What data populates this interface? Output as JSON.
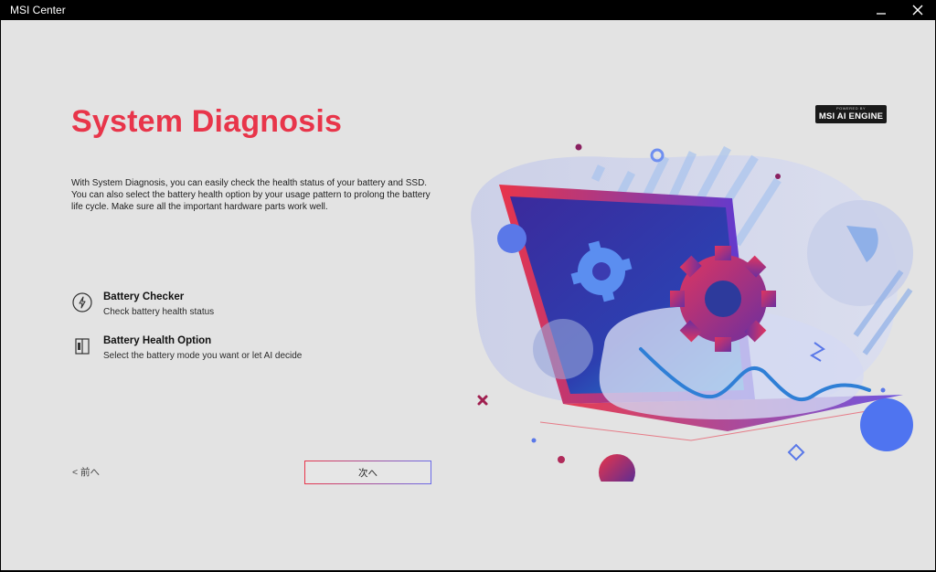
{
  "window": {
    "title": "MSI Center"
  },
  "page": {
    "title": "System Diagnosis",
    "description": "With System Diagnosis, you can easily check the health status of your battery and SSD. You can also select the battery health option by your usage pattern to prolong the battery life cycle. Make sure all the important hardware parts work well."
  },
  "options": [
    {
      "title": "Battery Checker",
      "subtitle": "Check battery health status",
      "icon": "battery-check-icon"
    },
    {
      "title": "Battery Health Option",
      "subtitle": "Select the battery mode you want or let AI decide",
      "icon": "battery-option-icon"
    }
  ],
  "badge": {
    "powered": "POWERED BY",
    "name": "MSI AI ENGINE"
  },
  "navigation": {
    "back_label": "< 前へ",
    "next_label": "次へ"
  },
  "colors": {
    "accent_red": "#e8354a",
    "accent_blue": "#6a6ae8",
    "background": "#e3e3e3",
    "titlebar": "#000000"
  }
}
